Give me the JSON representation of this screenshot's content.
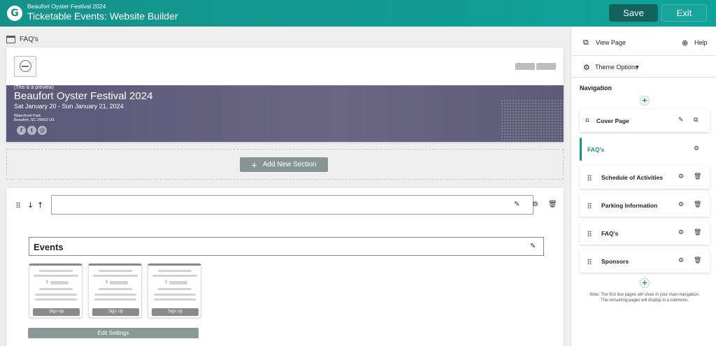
{
  "header": {
    "logo_letter": "G",
    "subtitle": "Beaufort Oyster Festival 2024",
    "title": "Ticketable Events: Website Builder",
    "save_label": "Save",
    "exit_label": "Exit"
  },
  "page": {
    "name": "FAQ's"
  },
  "preview": {
    "note": "(This is a preview)",
    "event_name": "Beaufort Oyster Festival 2024",
    "dates": "Sat January 20 - Sun January 21, 2024",
    "venue": "Waterfront Park",
    "address": "Beaufort, SC 29903 US",
    "social_icons": [
      "facebook-icon",
      "twitter-icon",
      "email-icon"
    ]
  },
  "add_section_label": "Add New Section",
  "section": {
    "title_value": "",
    "events_label": "Events",
    "cards": [
      {
        "price_symbol": "$",
        "button": "Sign Up"
      },
      {
        "price_symbol": "$",
        "button": "Sign Up"
      },
      {
        "price_symbol": "$",
        "button": "Sign Up"
      }
    ],
    "edit_settings_label": "Edit Settings"
  },
  "sidebar": {
    "view_page_label": "View Page",
    "help_label": "Help",
    "theme_options_label": "Theme Options",
    "navigation_label": "Navigation",
    "items": [
      {
        "label": "Cover Page"
      },
      {
        "label": "FAQ's"
      },
      {
        "label": "Schedule of Activities"
      },
      {
        "label": "Parking Information"
      },
      {
        "label": "FAQ's"
      },
      {
        "label": "Sponsors"
      }
    ],
    "note_line1": "Note: The first few pages will show in your main navigation.",
    "note_line2": "The remaining pages will display in a submenu."
  },
  "colors": {
    "brand_teal": "#15918a",
    "save_button": "#14625e",
    "banner": "#5b5878"
  }
}
